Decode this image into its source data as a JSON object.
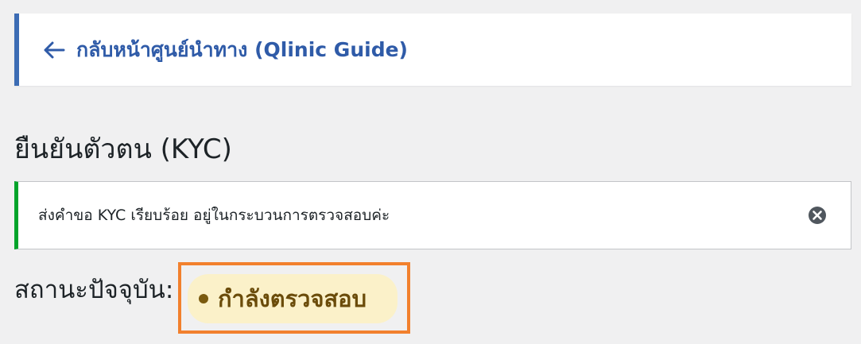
{
  "back_link": {
    "arrow_icon": "arrow-left-icon",
    "label": "กลับหน้าศูนย์นำทาง (Qlinic Guide)"
  },
  "page": {
    "title": "ยืนยันตัวตน (KYC)"
  },
  "notice": {
    "message": "ส่งคำขอ KYC เรียบร้อย อยู่ในกระบวนการตรวจสอบค่ะ",
    "dismiss_icon": "close-circle-icon",
    "accent_color": "#00a32a"
  },
  "status": {
    "label": "สถานะปัจจุบัน:",
    "badge_text": "กำลังตรวจสอบ",
    "badge_color": "#fbf1c9",
    "highlight_color": "#f2802d"
  },
  "colors": {
    "link": "#2f5ba8",
    "card_border": "#3c6cb4",
    "background": "#f0f0f1"
  }
}
